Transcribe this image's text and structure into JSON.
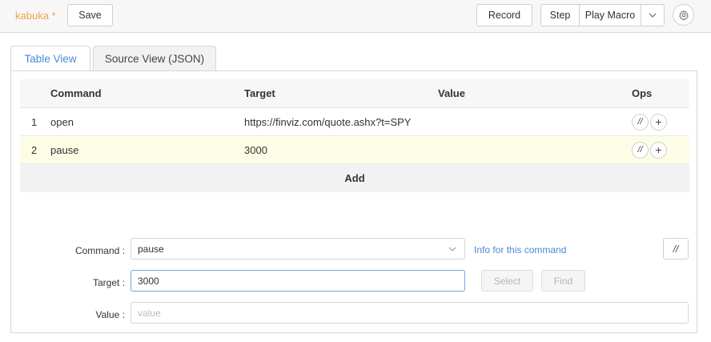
{
  "toolbar": {
    "macro_name": "kabuka *",
    "save_label": "Save",
    "record_label": "Record",
    "step_label": "Step",
    "play_label": "Play Macro",
    "dropdown_icon": "chevron-down-icon",
    "settings_icon": "gear-icon"
  },
  "tabs": [
    {
      "label": "Table View",
      "active": true
    },
    {
      "label": "Source View (JSON)",
      "active": false
    }
  ],
  "table": {
    "headers": {
      "command": "Command",
      "target": "Target",
      "value": "Value",
      "ops": "Ops"
    },
    "rows": [
      {
        "index": "1",
        "command": "open",
        "target": "https://finviz.com/quote.ashx?t=SPY",
        "value": "",
        "selected": false
      },
      {
        "index": "2",
        "command": "pause",
        "target": "3000",
        "value": "",
        "selected": true
      }
    ],
    "ops": {
      "comment_label": "//",
      "add_label": "+"
    },
    "add_label": "Add"
  },
  "editor": {
    "command_label": "Command",
    "command_value": "pause",
    "info_link": "Info for this command",
    "comment_toggle": "//",
    "target_label": "Target",
    "target_value": "3000",
    "select_label": "Select",
    "find_label": "Find",
    "value_label": "Value",
    "value_placeholder": "value"
  },
  "colors": {
    "accent": "#4a8bd6",
    "macro_name": "#f0a34a",
    "selected_row": "#fdfde6"
  }
}
